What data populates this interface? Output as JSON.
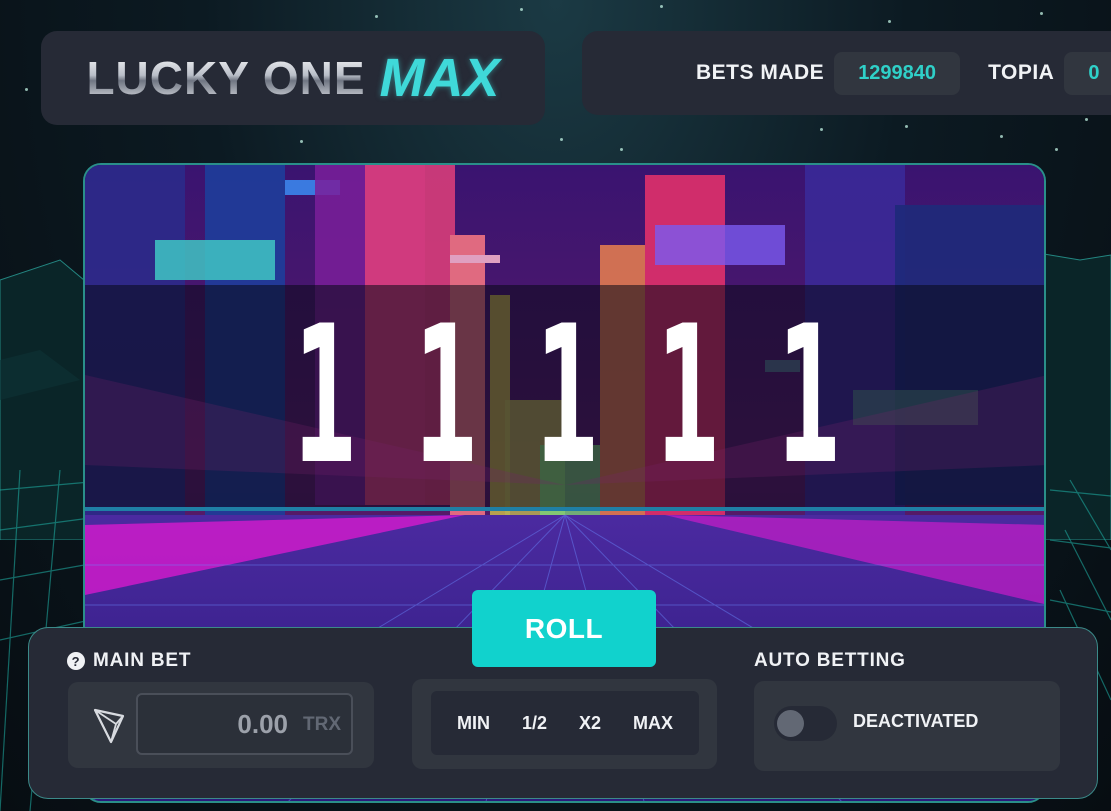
{
  "header": {
    "logo_main": "LUCKY ONE",
    "logo_accent": "MAX",
    "stats": [
      {
        "label": "BETS MADE",
        "value": "1299840"
      },
      {
        "label": "TOPIA",
        "value": "0"
      }
    ]
  },
  "game": {
    "digits": [
      "1",
      "1",
      "1",
      "1",
      "1"
    ]
  },
  "roll_label": "ROLL",
  "main_bet": {
    "title": "MAIN BET",
    "help_icon": "?",
    "currency_icon": "tron-icon",
    "value": "0.00",
    "unit": "TRX"
  },
  "quick_buttons": [
    "MIN",
    "1/2",
    "X2",
    "MAX"
  ],
  "auto_betting": {
    "title": "AUTO BETTING",
    "status": "DEACTIVATED",
    "enabled": false
  },
  "colors": {
    "accent": "#11d2cd",
    "panel": "#262a36",
    "panel_inner": "#31363f",
    "stat_value": "#2fd0c8"
  }
}
